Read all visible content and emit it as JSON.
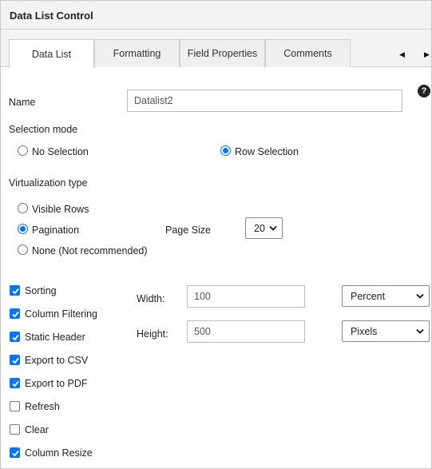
{
  "window": {
    "title": "Data List Control"
  },
  "tabs": [
    {
      "label": "Data List",
      "active": true
    },
    {
      "label": "Formatting",
      "active": false
    },
    {
      "label": "Field Properties",
      "active": false
    },
    {
      "label": "Comments",
      "active": false
    }
  ],
  "name": {
    "label": "Name",
    "value": "Datalist2"
  },
  "selection_mode": {
    "label": "Selection mode",
    "options": [
      "No Selection",
      "Row Selection"
    ],
    "selected": "Row Selection"
  },
  "virtualization": {
    "label": "Virtualization type",
    "options": [
      "Visible Rows",
      "Pagination",
      "None (Not recommended)"
    ],
    "selected": "Pagination",
    "page_size_label": "Page Size",
    "page_size_value": "20"
  },
  "features": [
    {
      "label": "Sorting",
      "checked": true
    },
    {
      "label": "Column Filtering",
      "checked": true
    },
    {
      "label": "Static Header",
      "checked": true
    },
    {
      "label": "Export to CSV",
      "checked": true
    },
    {
      "label": "Export to PDF",
      "checked": true
    },
    {
      "label": "Refresh",
      "checked": false
    },
    {
      "label": "Clear",
      "checked": false
    },
    {
      "label": "Column Resize",
      "checked": true
    }
  ],
  "size": {
    "width_label": "Width:",
    "width_value": "100",
    "width_unit": "Percent",
    "height_label": "Height:",
    "height_value": "500",
    "height_unit": "Pixels"
  },
  "colors": {
    "accent": "#0075ff",
    "header_bg": "#f3f3f3"
  },
  "icons": [
    "help-icon",
    "chevron-left-icon",
    "chevron-right-icon",
    "chevron-down-icon",
    "checkmark-icon"
  ]
}
